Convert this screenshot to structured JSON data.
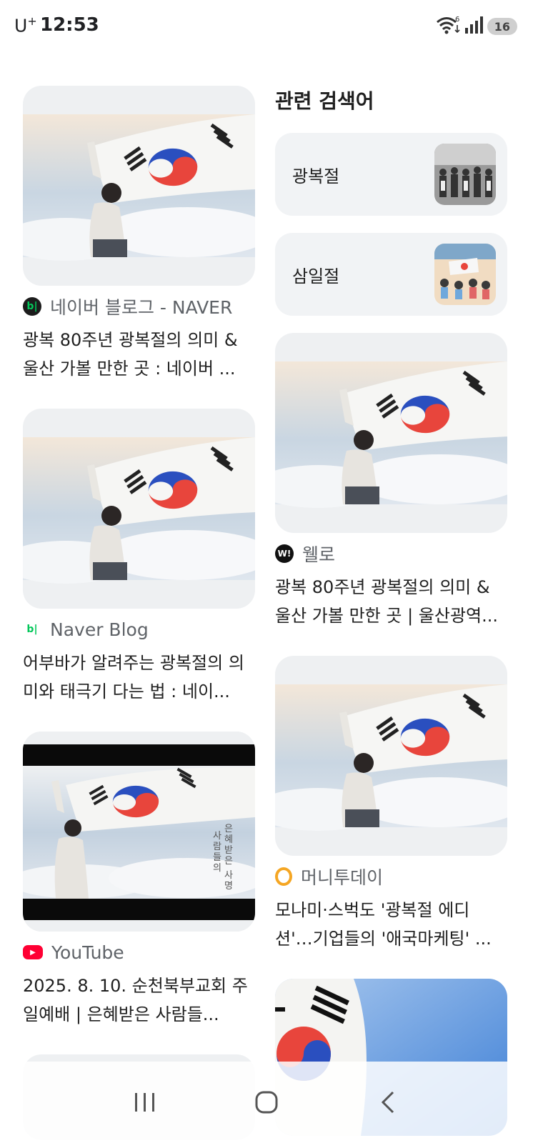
{
  "status_bar": {
    "carrier": "U",
    "carrier_mark": "+",
    "time": "12:53",
    "battery": "16",
    "wifi_label": "6"
  },
  "related": {
    "heading": "관련 검색어",
    "items": [
      {
        "label": "광복절"
      },
      {
        "label": "삼일절"
      }
    ]
  },
  "left_cards": [
    {
      "source": "네이버 블로그 - NAVER",
      "source_icon": "naver-blog-icon",
      "title": "광복 80주년 광복절의 의미 & 울산 가볼 만한 곳 : 네이버 ..."
    },
    {
      "source": "Naver Blog",
      "source_icon": "naver-blog-icon",
      "title": "어부바가 알려주는 광복절의 의미와 태극기 다는 법 : 네이..."
    },
    {
      "source": "YouTube",
      "source_icon": "youtube-icon",
      "title": "2025. 8. 10. 순천북부교회 주일예배 | 은혜받은 사람들...",
      "overlay_text": "사은\n람혜\n들받\n의은\n사\n명"
    }
  ],
  "right_cards": [
    {
      "source": "웰로",
      "source_icon": "wello-icon",
      "title": "광복 80주년 광복절의 의미 & 울산 가볼 만한 곳 | 울산광역..."
    },
    {
      "source": "머니투데이",
      "source_icon": "moneytoday-icon",
      "title": "모나미·스벅도 '광복절 에디션'…기업들의 '애국마케팅' ..."
    }
  ],
  "colors": {
    "naver_green": "#03c75a",
    "youtube_red": "#ff0033",
    "moneytoday_orange": "#f5a623",
    "card_bg": "#eef0f2"
  }
}
